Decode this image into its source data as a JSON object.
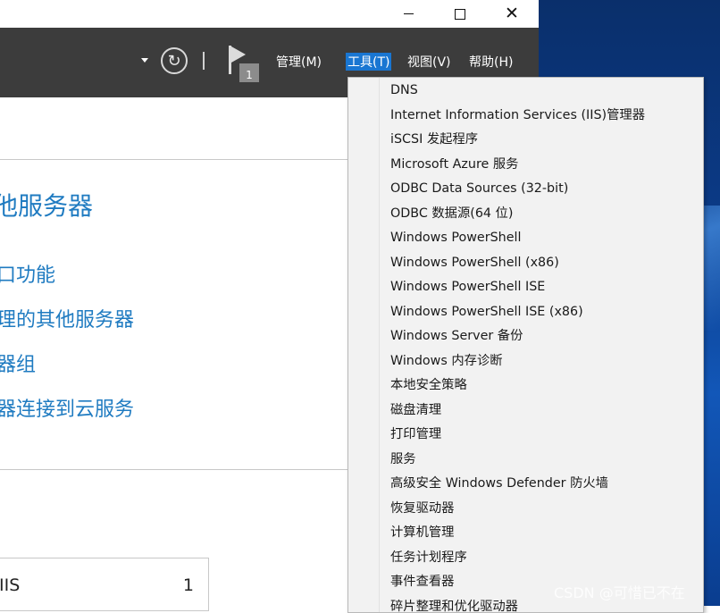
{
  "window": {
    "controls": [
      "minimize-icon",
      "maximize-icon",
      "close-icon"
    ]
  },
  "header": {
    "refresh_icon": "refresh-icon",
    "flag_icon": "flag-icon",
    "notification_count": "1",
    "menus": [
      {
        "label": "管理(M)"
      },
      {
        "label": "工具(T)"
      },
      {
        "label": "视图(V)"
      },
      {
        "label": "帮助(H)"
      }
    ]
  },
  "main": {
    "heading": "他服务器",
    "links": [
      "口功能",
      "理的其他服务器",
      "器组",
      "器连接到云服务"
    ],
    "tile": {
      "name": "IIS",
      "count": "1"
    }
  },
  "tools_menu": {
    "items": [
      "DNS",
      "Internet Information Services (IIS)管理器",
      "iSCSI 发起程序",
      "Microsoft Azure 服务",
      "ODBC Data Sources (32-bit)",
      "ODBC 数据源(64 位)",
      "Windows PowerShell",
      "Windows PowerShell (x86)",
      "Windows PowerShell ISE",
      "Windows PowerShell ISE (x86)",
      "Windows Server 备份",
      "Windows 内存诊断",
      "本地安全策略",
      "磁盘清理",
      "打印管理",
      "服务",
      "高级安全 Windows Defender 防火墙",
      "恢复驱动器",
      "计算机管理",
      "任务计划程序",
      "事件查看器",
      "碎片整理和优化驱动器"
    ]
  },
  "watermark": "CSDN @可惜已不在",
  "colors": {
    "header_bg": "#3c3c3c",
    "accent": "#1976d2",
    "link": "#1f7bc1",
    "menu_bg": "#f2f2f2"
  }
}
